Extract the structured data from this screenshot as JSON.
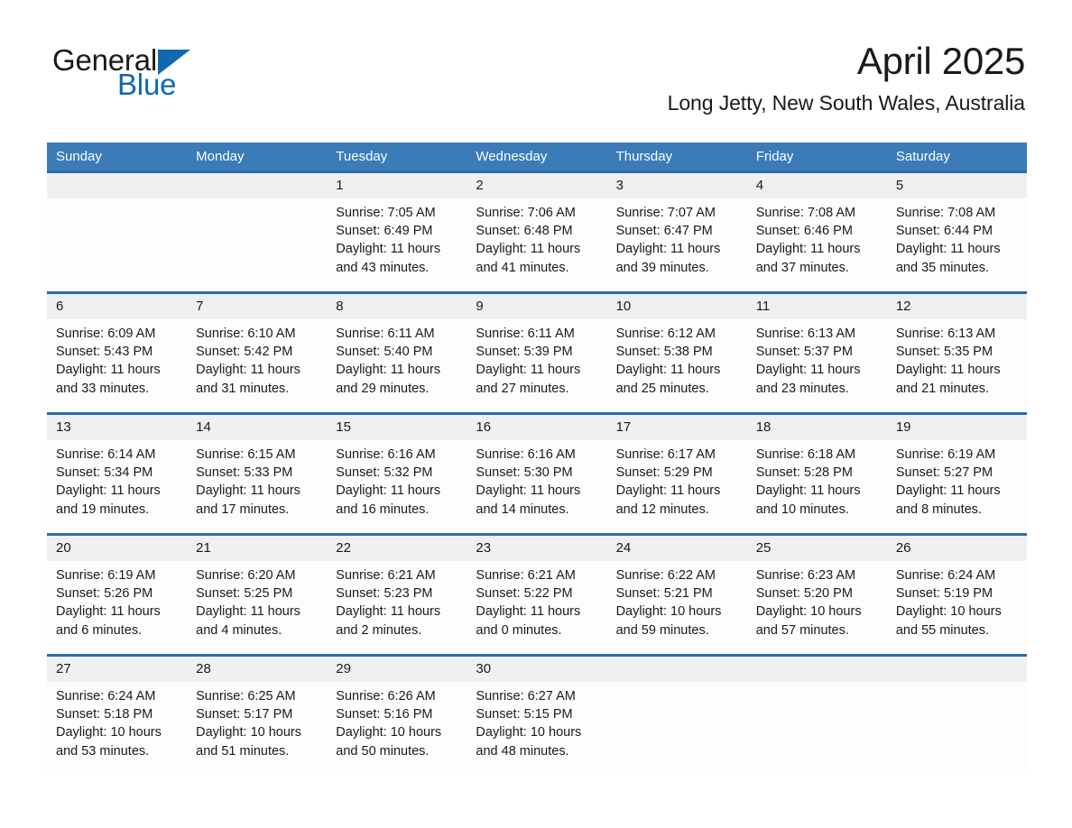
{
  "logo": {
    "text_dark": "General",
    "text_blue": "Blue",
    "triangle_color": "#1068b0"
  },
  "header": {
    "month_title": "April 2025",
    "location": "Long Jetty, New South Wales, Australia"
  },
  "colors": {
    "header_blue": "#3b7bb8",
    "rule_blue": "#2b6cab",
    "daynum_band": "#f0f0f0",
    "text": "#1a1a1a"
  },
  "weekdays": [
    "Sunday",
    "Monday",
    "Tuesday",
    "Wednesday",
    "Thursday",
    "Friday",
    "Saturday"
  ],
  "weeks": [
    [
      {
        "day": "",
        "sunrise": "",
        "sunset": "",
        "daylight_1": "",
        "daylight_2": ""
      },
      {
        "day": "",
        "sunrise": "",
        "sunset": "",
        "daylight_1": "",
        "daylight_2": ""
      },
      {
        "day": "1",
        "sunrise": "Sunrise: 7:05 AM",
        "sunset": "Sunset: 6:49 PM",
        "daylight_1": "Daylight: 11 hours",
        "daylight_2": "and 43 minutes."
      },
      {
        "day": "2",
        "sunrise": "Sunrise: 7:06 AM",
        "sunset": "Sunset: 6:48 PM",
        "daylight_1": "Daylight: 11 hours",
        "daylight_2": "and 41 minutes."
      },
      {
        "day": "3",
        "sunrise": "Sunrise: 7:07 AM",
        "sunset": "Sunset: 6:47 PM",
        "daylight_1": "Daylight: 11 hours",
        "daylight_2": "and 39 minutes."
      },
      {
        "day": "4",
        "sunrise": "Sunrise: 7:08 AM",
        "sunset": "Sunset: 6:46 PM",
        "daylight_1": "Daylight: 11 hours",
        "daylight_2": "and 37 minutes."
      },
      {
        "day": "5",
        "sunrise": "Sunrise: 7:08 AM",
        "sunset": "Sunset: 6:44 PM",
        "daylight_1": "Daylight: 11 hours",
        "daylight_2": "and 35 minutes."
      }
    ],
    [
      {
        "day": "6",
        "sunrise": "Sunrise: 6:09 AM",
        "sunset": "Sunset: 5:43 PM",
        "daylight_1": "Daylight: 11 hours",
        "daylight_2": "and 33 minutes."
      },
      {
        "day": "7",
        "sunrise": "Sunrise: 6:10 AM",
        "sunset": "Sunset: 5:42 PM",
        "daylight_1": "Daylight: 11 hours",
        "daylight_2": "and 31 minutes."
      },
      {
        "day": "8",
        "sunrise": "Sunrise: 6:11 AM",
        "sunset": "Sunset: 5:40 PM",
        "daylight_1": "Daylight: 11 hours",
        "daylight_2": "and 29 minutes."
      },
      {
        "day": "9",
        "sunrise": "Sunrise: 6:11 AM",
        "sunset": "Sunset: 5:39 PM",
        "daylight_1": "Daylight: 11 hours",
        "daylight_2": "and 27 minutes."
      },
      {
        "day": "10",
        "sunrise": "Sunrise: 6:12 AM",
        "sunset": "Sunset: 5:38 PM",
        "daylight_1": "Daylight: 11 hours",
        "daylight_2": "and 25 minutes."
      },
      {
        "day": "11",
        "sunrise": "Sunrise: 6:13 AM",
        "sunset": "Sunset: 5:37 PM",
        "daylight_1": "Daylight: 11 hours",
        "daylight_2": "and 23 minutes."
      },
      {
        "day": "12",
        "sunrise": "Sunrise: 6:13 AM",
        "sunset": "Sunset: 5:35 PM",
        "daylight_1": "Daylight: 11 hours",
        "daylight_2": "and 21 minutes."
      }
    ],
    [
      {
        "day": "13",
        "sunrise": "Sunrise: 6:14 AM",
        "sunset": "Sunset: 5:34 PM",
        "daylight_1": "Daylight: 11 hours",
        "daylight_2": "and 19 minutes."
      },
      {
        "day": "14",
        "sunrise": "Sunrise: 6:15 AM",
        "sunset": "Sunset: 5:33 PM",
        "daylight_1": "Daylight: 11 hours",
        "daylight_2": "and 17 minutes."
      },
      {
        "day": "15",
        "sunrise": "Sunrise: 6:16 AM",
        "sunset": "Sunset: 5:32 PM",
        "daylight_1": "Daylight: 11 hours",
        "daylight_2": "and 16 minutes."
      },
      {
        "day": "16",
        "sunrise": "Sunrise: 6:16 AM",
        "sunset": "Sunset: 5:30 PM",
        "daylight_1": "Daylight: 11 hours",
        "daylight_2": "and 14 minutes."
      },
      {
        "day": "17",
        "sunrise": "Sunrise: 6:17 AM",
        "sunset": "Sunset: 5:29 PM",
        "daylight_1": "Daylight: 11 hours",
        "daylight_2": "and 12 minutes."
      },
      {
        "day": "18",
        "sunrise": "Sunrise: 6:18 AM",
        "sunset": "Sunset: 5:28 PM",
        "daylight_1": "Daylight: 11 hours",
        "daylight_2": "and 10 minutes."
      },
      {
        "day": "19",
        "sunrise": "Sunrise: 6:19 AM",
        "sunset": "Sunset: 5:27 PM",
        "daylight_1": "Daylight: 11 hours",
        "daylight_2": "and 8 minutes."
      }
    ],
    [
      {
        "day": "20",
        "sunrise": "Sunrise: 6:19 AM",
        "sunset": "Sunset: 5:26 PM",
        "daylight_1": "Daylight: 11 hours",
        "daylight_2": "and 6 minutes."
      },
      {
        "day": "21",
        "sunrise": "Sunrise: 6:20 AM",
        "sunset": "Sunset: 5:25 PM",
        "daylight_1": "Daylight: 11 hours",
        "daylight_2": "and 4 minutes."
      },
      {
        "day": "22",
        "sunrise": "Sunrise: 6:21 AM",
        "sunset": "Sunset: 5:23 PM",
        "daylight_1": "Daylight: 11 hours",
        "daylight_2": "and 2 minutes."
      },
      {
        "day": "23",
        "sunrise": "Sunrise: 6:21 AM",
        "sunset": "Sunset: 5:22 PM",
        "daylight_1": "Daylight: 11 hours",
        "daylight_2": "and 0 minutes."
      },
      {
        "day": "24",
        "sunrise": "Sunrise: 6:22 AM",
        "sunset": "Sunset: 5:21 PM",
        "daylight_1": "Daylight: 10 hours",
        "daylight_2": "and 59 minutes."
      },
      {
        "day": "25",
        "sunrise": "Sunrise: 6:23 AM",
        "sunset": "Sunset: 5:20 PM",
        "daylight_1": "Daylight: 10 hours",
        "daylight_2": "and 57 minutes."
      },
      {
        "day": "26",
        "sunrise": "Sunrise: 6:24 AM",
        "sunset": "Sunset: 5:19 PM",
        "daylight_1": "Daylight: 10 hours",
        "daylight_2": "and 55 minutes."
      }
    ],
    [
      {
        "day": "27",
        "sunrise": "Sunrise: 6:24 AM",
        "sunset": "Sunset: 5:18 PM",
        "daylight_1": "Daylight: 10 hours",
        "daylight_2": "and 53 minutes."
      },
      {
        "day": "28",
        "sunrise": "Sunrise: 6:25 AM",
        "sunset": "Sunset: 5:17 PM",
        "daylight_1": "Daylight: 10 hours",
        "daylight_2": "and 51 minutes."
      },
      {
        "day": "29",
        "sunrise": "Sunrise: 6:26 AM",
        "sunset": "Sunset: 5:16 PM",
        "daylight_1": "Daylight: 10 hours",
        "daylight_2": "and 50 minutes."
      },
      {
        "day": "30",
        "sunrise": "Sunrise: 6:27 AM",
        "sunset": "Sunset: 5:15 PM",
        "daylight_1": "Daylight: 10 hours",
        "daylight_2": "and 48 minutes."
      },
      {
        "day": "",
        "sunrise": "",
        "sunset": "",
        "daylight_1": "",
        "daylight_2": ""
      },
      {
        "day": "",
        "sunrise": "",
        "sunset": "",
        "daylight_1": "",
        "daylight_2": ""
      },
      {
        "day": "",
        "sunrise": "",
        "sunset": "",
        "daylight_1": "",
        "daylight_2": ""
      }
    ]
  ]
}
